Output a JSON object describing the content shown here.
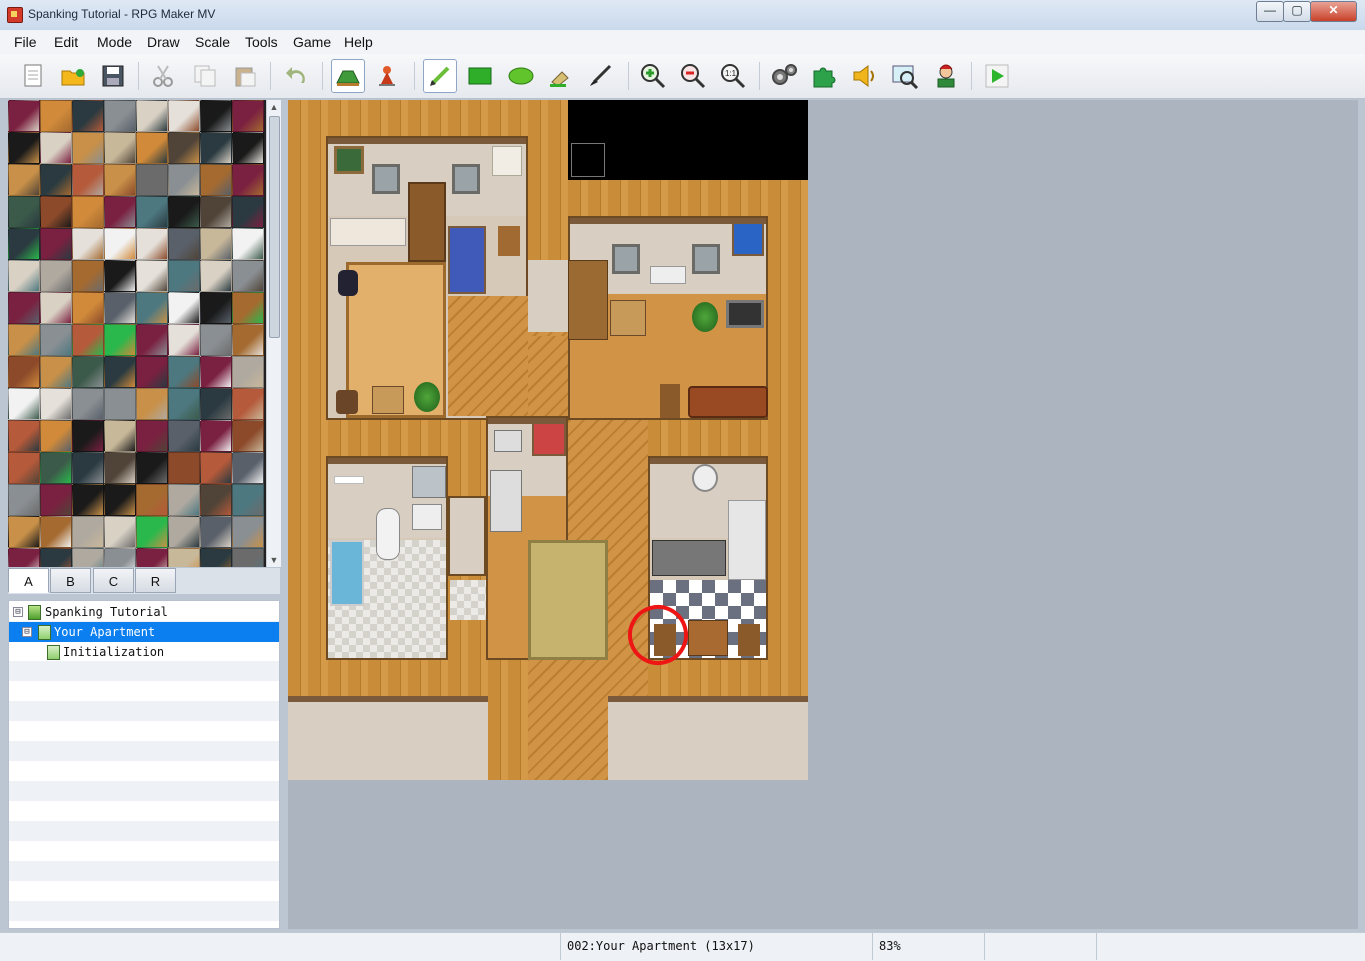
{
  "window": {
    "title": "Spanking Tutorial - RPG Maker MV",
    "minimize_label": "—",
    "maximize_label": "▢",
    "close_label": "✕"
  },
  "menu": [
    "File",
    "Edit",
    "Mode",
    "Draw",
    "Scale",
    "Tools",
    "Game",
    "Help"
  ],
  "toolbar": {
    "icons": [
      "new-project-icon",
      "open-project-icon",
      "save-project-icon",
      "cut-icon",
      "copy-icon",
      "paste-icon",
      "undo-icon",
      "map-mode-icon",
      "event-mode-icon",
      "pencil-icon",
      "rectangle-icon",
      "ellipse-icon",
      "fill-icon",
      "shadow-pen-icon",
      "zoom-in-icon",
      "zoom-out-icon",
      "actual-size-icon",
      "database-icon",
      "plugin-manager-icon",
      "sound-test-icon",
      "event-searcher-icon",
      "character-generator-icon",
      "playtest-icon"
    ],
    "active": [
      "map-mode-icon",
      "pencil-icon"
    ]
  },
  "tileset_tabs": [
    "A",
    "B",
    "C",
    "R"
  ],
  "tileset_selected_tab": "A",
  "map_tree": [
    {
      "label": "Spanking Tutorial",
      "level": 0,
      "toggle": "⊟",
      "type": "project"
    },
    {
      "label": "Your Apartment",
      "level": 1,
      "toggle": "⊟",
      "type": "map",
      "selected": true
    },
    {
      "label": "Initialization",
      "level": 2,
      "type": "map"
    }
  ],
  "status": {
    "map_info": "002:Your Apartment (13x17)",
    "zoom": "83%"
  },
  "colors": {
    "selection": "#0b7ff0",
    "annotation": "#ee1515"
  }
}
